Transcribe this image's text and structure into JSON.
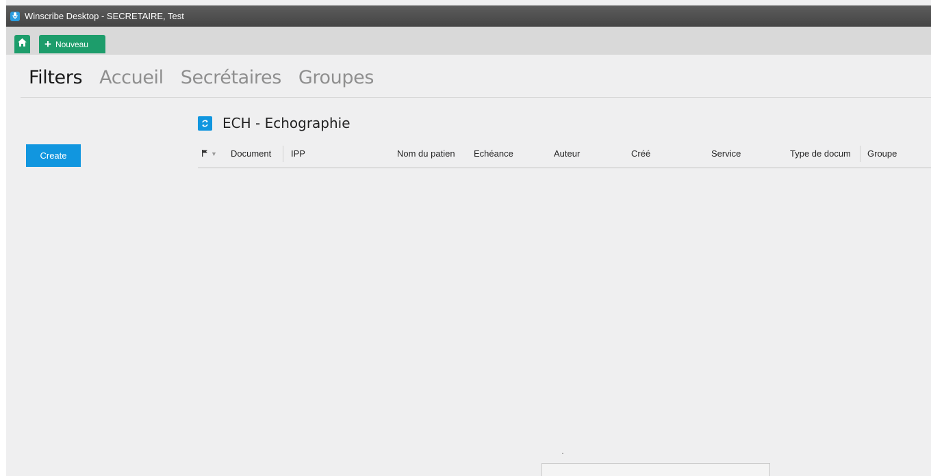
{
  "window": {
    "title": "Winscribe Desktop - SECRETAIRE, Test",
    "icon": "microphone-icon"
  },
  "toolbar": {
    "home_icon": "home-icon",
    "new_label": "Nouveau",
    "new_icon": "plus-icon"
  },
  "nav": {
    "tabs": [
      {
        "label": "Filters",
        "active": true
      },
      {
        "label": "Accueil",
        "active": false
      },
      {
        "label": "Secrétaires",
        "active": false
      },
      {
        "label": "Groupes",
        "active": false
      }
    ]
  },
  "sidebar": {
    "create_label": "Create"
  },
  "section": {
    "title": "ECH - Echographie",
    "icon": "refresh-icon"
  },
  "grid": {
    "columns": [
      "Document",
      "IPP",
      "Nom du patien",
      "Echéance",
      "Auteur",
      "Créé",
      "Service",
      "Type de docum",
      "Groupe"
    ],
    "rows": []
  },
  "colors": {
    "accent_blue": "#1196df",
    "accent_green": "#1d9d6b",
    "titlebar": "#4f4f4f"
  }
}
